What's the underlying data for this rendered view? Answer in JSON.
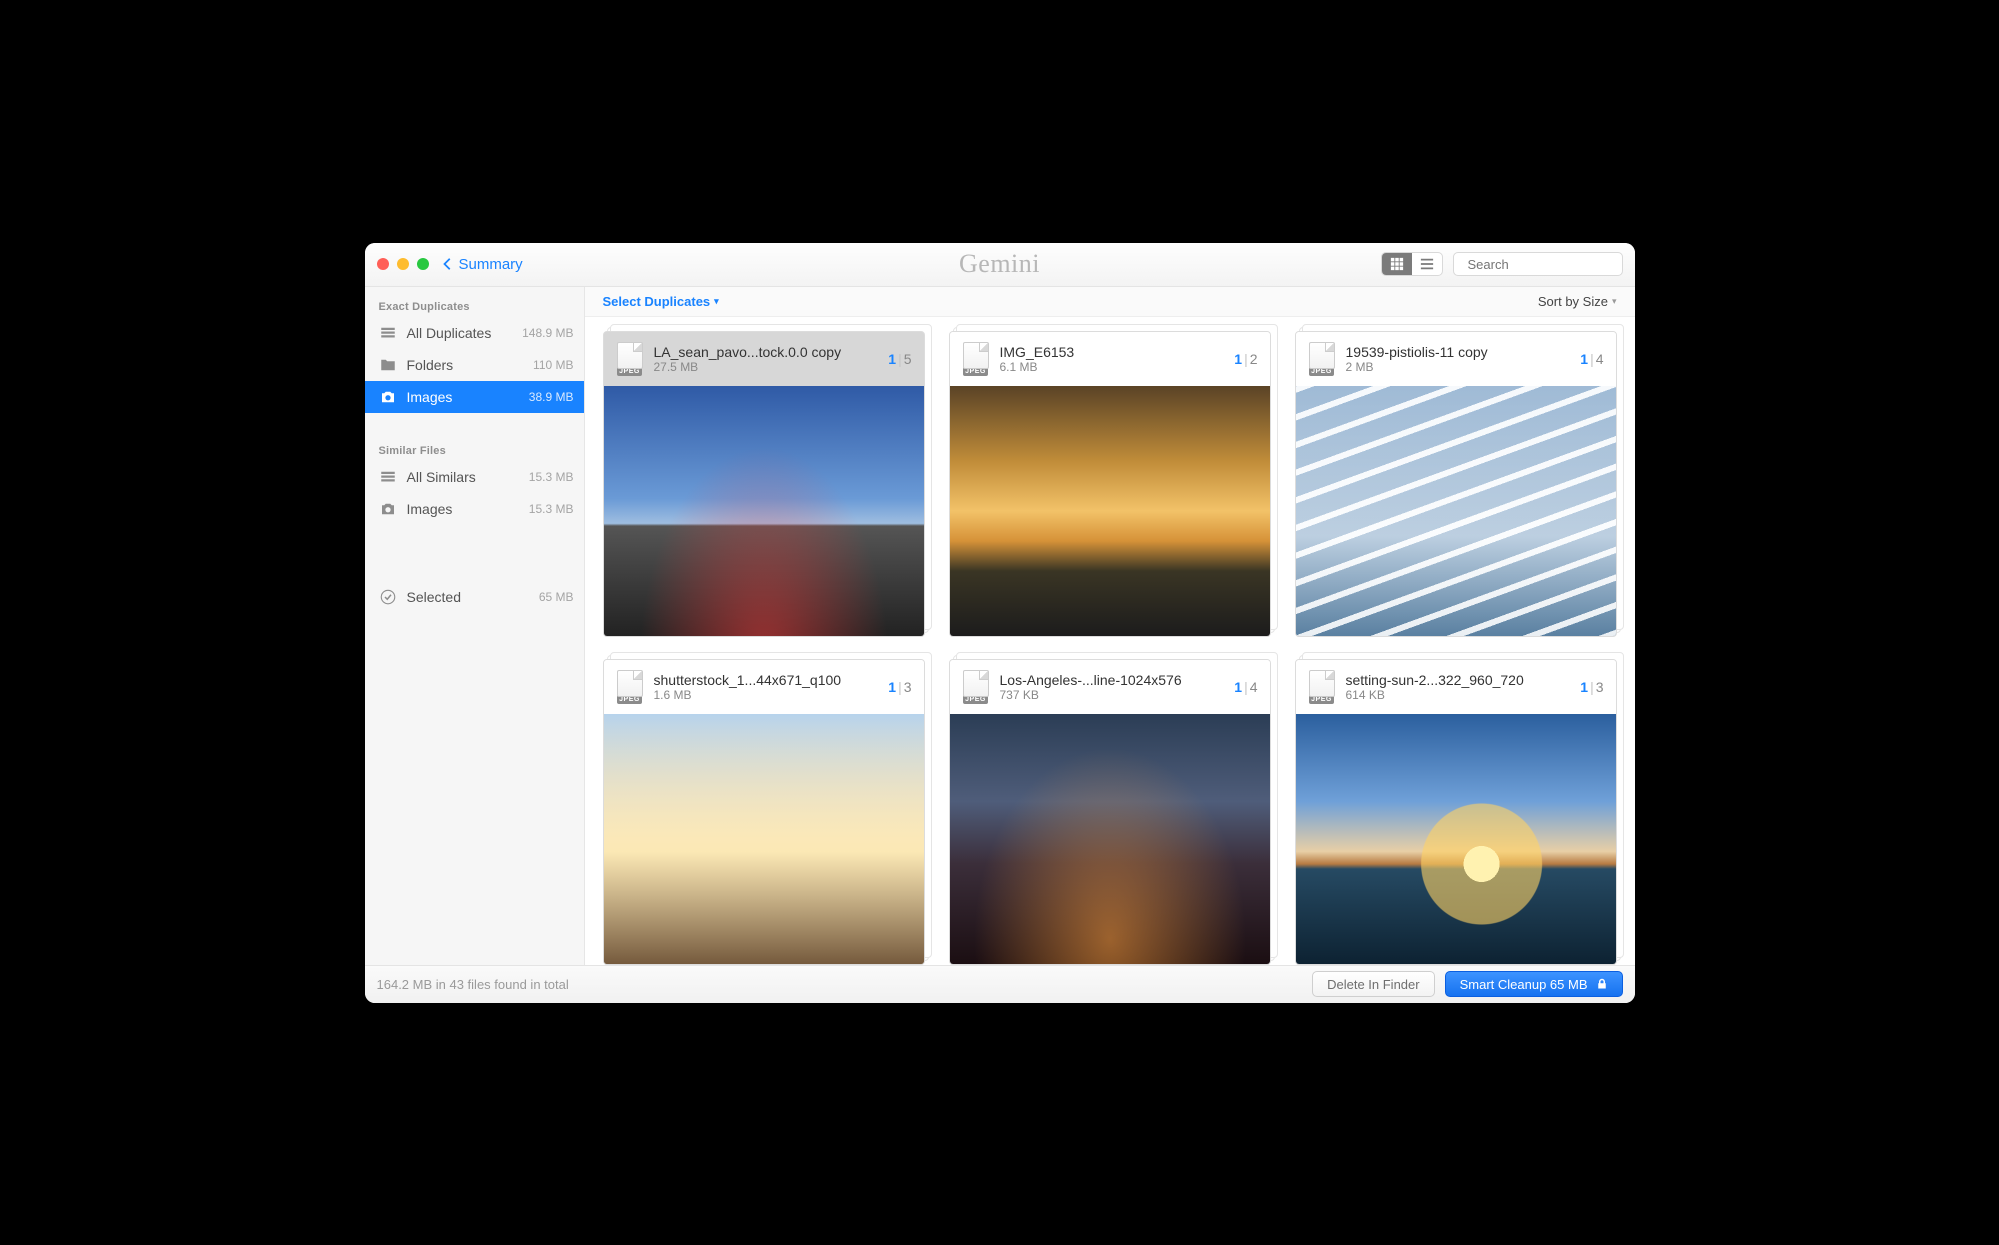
{
  "brand": "Gemini",
  "back_label": "Summary",
  "search": {
    "placeholder": "Search"
  },
  "sidebar": {
    "section_a": "Exact Duplicates",
    "section_b": "Similar Files",
    "items_a": [
      {
        "label": "All Duplicates",
        "size": "148.9 MB"
      },
      {
        "label": "Folders",
        "size": "110 MB"
      },
      {
        "label": "Images",
        "size": "38.9 MB"
      }
    ],
    "items_b": [
      {
        "label": "All Similars",
        "size": "15.3 MB"
      },
      {
        "label": "Images",
        "size": "15.3 MB"
      }
    ],
    "selected": {
      "label": "Selected",
      "size": "65 MB"
    }
  },
  "content": {
    "select_label": "Select Duplicates",
    "sort_label": "Sort by Size",
    "cards": [
      {
        "title": "LA_sean_pavo...tock.0.0 copy",
        "size": "27.5 MB",
        "sel": "1",
        "total": "5",
        "thumb": "thumb-city",
        "tag": "JPEG"
      },
      {
        "title": "IMG_E6153",
        "size": "6.1 MB",
        "sel": "1",
        "total": "2",
        "thumb": "thumb-sunset",
        "tag": "JPEG"
      },
      {
        "title": "19539-pistiolis-11 copy",
        "size": "2 MB",
        "sel": "1",
        "total": "4",
        "thumb": "thumb-archi",
        "tag": "JPEG"
      },
      {
        "title": "shutterstock_1...44x671_q100",
        "size": "1.6 MB",
        "sel": "1",
        "total": "3",
        "thumb": "thumb-blvd",
        "tag": "JPEG"
      },
      {
        "title": "Los-Angeles-...line-1024x576",
        "size": "737 KB",
        "sel": "1",
        "total": "4",
        "thumb": "thumb-night",
        "tag": "JPEG"
      },
      {
        "title": "setting-sun-2...322_960_720",
        "size": "614 KB",
        "sel": "1",
        "total": "3",
        "thumb": "thumb-sea",
        "tag": "JPEG"
      }
    ]
  },
  "footer": {
    "status": "164.2 MB in 43 files found in total",
    "delete_label": "Delete In Finder",
    "cleanup_label": "Smart Cleanup 65 MB"
  }
}
